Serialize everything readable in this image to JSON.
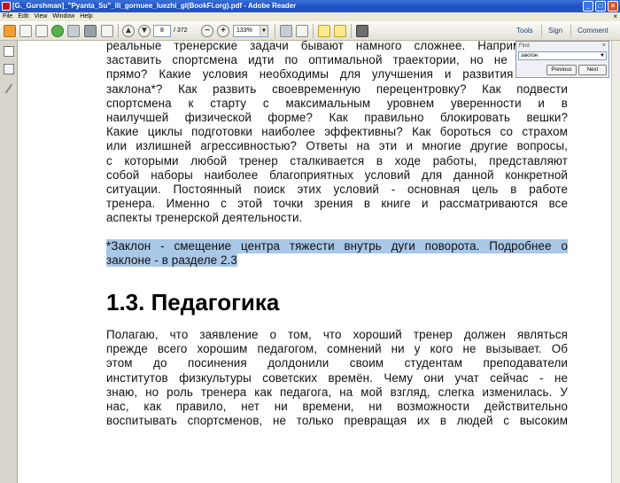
{
  "window": {
    "title": "[G._Gurshman]_\"Pyanta_Su\"_ili_gornuee_luezhi_gl(BookFi.org).pdf - Adobe Reader",
    "minimize": "_",
    "maximize": "□",
    "close": "×"
  },
  "menu": {
    "items": [
      "File",
      "Edit",
      "View",
      "Window",
      "Help"
    ],
    "close": "×"
  },
  "toolbar": {
    "page_current": "8",
    "page_total": "/ 372",
    "zoom": "133%",
    "zoom_out": "−",
    "zoom_in": "+",
    "tools": "Tools",
    "sign": "Sign",
    "comment": "Comment"
  },
  "find": {
    "label": "Find",
    "value": "заклон",
    "previous": "Previous",
    "next": "Next",
    "close": "×"
  },
  "document": {
    "para1": [
      "реальные тренерские задачи бывают намного сложнее. Например, как",
      "заставить спортсмена идти по оптимальной траектории, но не слишком",
      "прямо? Какие условия необходимы для улучшения и развития техники",
      "заклона*? Как развить своевременную перецентровку? Как подвести",
      "спортсмена к старту с максимальным уровнем уверенности и в",
      "наилучшей физической форме? Как правильно блокировать вешки?",
      "Какие циклы подготовки наиболее эффективны? Как бороться со страхом",
      "или излишней агрессивностью? Ответы на эти и многие другие вопросы,",
      "с которыми любой тренер сталкивается в ходе работы, представляют",
      "собой наборы наиболее благоприятных условий для данной конкретной",
      "ситуации. Постоянный поиск этих условий - основная цель в работе",
      "тренера. Именно с этой точки зрения в книге и рассматриваются все",
      "аспекты тренерской деятельности."
    ],
    "footnote": [
      "*Заклон - смещение центра тяжести внутрь дуги поворота. Подробнее о",
      "заклоне - в разделе 2.3"
    ],
    "heading": "1.3. Педагогика",
    "para2": [
      "Полагаю, что заявление о том, что хороший тренер должен являться",
      "прежде всего хорошим педагогом, сомнений ни у кого не вызывает. Об",
      "этом до посинения долдонили своим студентам преподаватели",
      "институтов физкультуры советских времён. Чему они учат сейчас - не",
      "знаю, но роль тренера как педагога, на мой взгляд, слегка изменилась. У",
      "нас, как правило, нет ни времени, ни возможности действительно",
      "воспитывать спортсменов, не только превращая их в людей с высоким"
    ]
  },
  "colors": {
    "titlebar": "#1c4fc0",
    "selection": "#a9c7e6",
    "chrome": "#ece9d8"
  }
}
